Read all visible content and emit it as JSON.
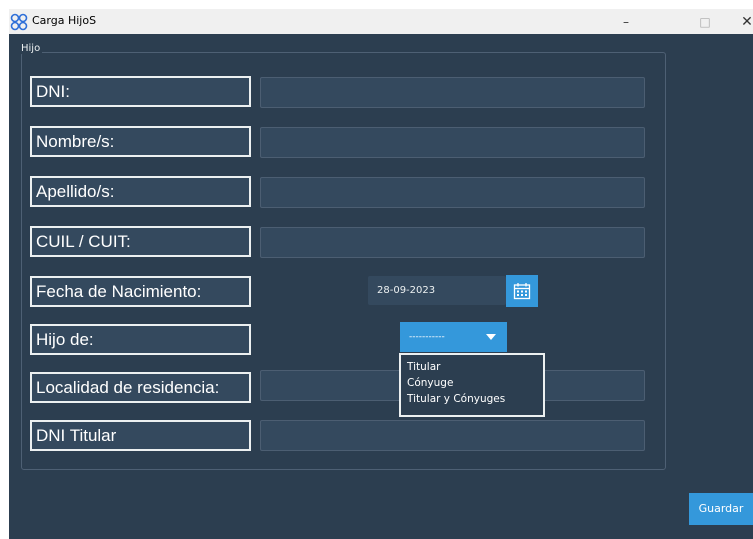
{
  "window": {
    "title": "Carga HijoS",
    "icon": "butterfly-app-icon",
    "controls": {
      "minimize": "–",
      "maximize": "□",
      "close": "✕"
    }
  },
  "group": {
    "title": "Hijo"
  },
  "fields": [
    {
      "label": "DNI:",
      "value": ""
    },
    {
      "label": "Nombre/s:",
      "value": ""
    },
    {
      "label": "Apellido/s:",
      "value": ""
    },
    {
      "label": "CUIL / CUIT:",
      "value": ""
    },
    {
      "label": "Fecha de Nacimiento:",
      "value": "28-09-2023"
    },
    {
      "label": "Hijo de:",
      "value": "-----------"
    },
    {
      "label": "Localidad de residencia:",
      "value": ""
    },
    {
      "label": "DNI Titular",
      "value": ""
    }
  ],
  "dropdown": {
    "options": [
      "Titular",
      "Cónyuge",
      "Titular y Cónyuges"
    ]
  },
  "buttons": {
    "save": "Guardar"
  },
  "colors": {
    "background": "#2c3e50",
    "field": "#34495e",
    "accent": "#3498db",
    "text": "#ecf0f1"
  }
}
